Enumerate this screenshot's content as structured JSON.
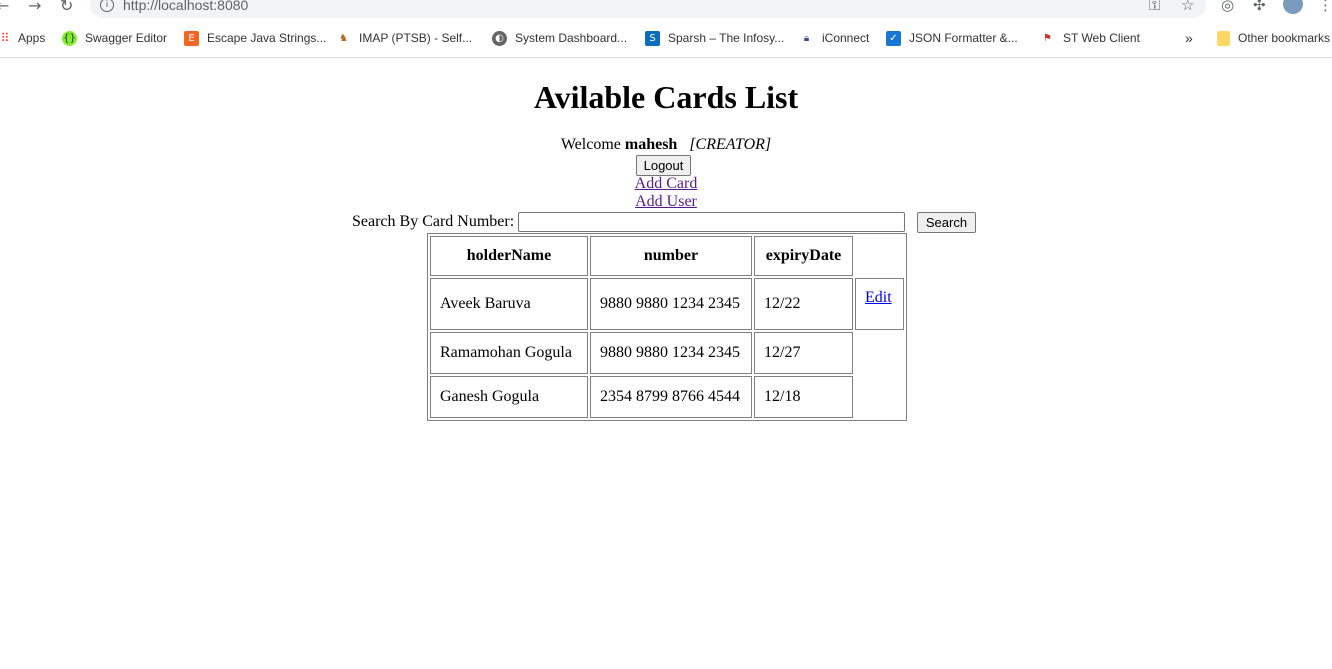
{
  "browser": {
    "url": "http://localhost:8080",
    "bookmarks": [
      {
        "label": "Apps",
        "icon": "apps-grid-icon"
      },
      {
        "label": "Swagger Editor",
        "icon": "swagger-icon"
      },
      {
        "label": "Escape Java Strings...",
        "icon": "e-logo-icon"
      },
      {
        "label": "IMAP (PTSB) - Self...",
        "icon": "camel-icon"
      },
      {
        "label": "System Dashboard...",
        "icon": "globe-icon"
      },
      {
        "label": "Sparsh – The Infosy...",
        "icon": "s-logo-icon"
      },
      {
        "label": "iConnect",
        "icon": "lock-icon"
      },
      {
        "label": "JSON Formatter &...",
        "icon": "check-icon"
      },
      {
        "label": "ST Web Client",
        "icon": "st-logo-icon"
      },
      {
        "label": "Other bookmarks",
        "icon": "folder-icon"
      }
    ],
    "overflow_label": "»"
  },
  "page": {
    "title": "Avilable Cards List",
    "welcome_prefix": "Welcome",
    "username": "mahesh",
    "role": "[CREATOR]",
    "logout_label": "Logout",
    "add_card_label": "Add Card",
    "add_user_label": "Add User",
    "search_label": "Search By Card Number:",
    "search_value": "",
    "search_button": "Search"
  },
  "table": {
    "headers": [
      "holderName",
      "number",
      "expiryDate"
    ],
    "rows": [
      {
        "holderName": "Aveek Baruva",
        "number": "9880 9880 1234 2345",
        "expiryDate": "12/22",
        "action": "Edit"
      },
      {
        "holderName": "Ramamohan Gogula",
        "number": "9880 9880 1234 2345",
        "expiryDate": "12/27"
      },
      {
        "holderName": "Ganesh Gogula",
        "number": "2354 8799 8766 4544",
        "expiryDate": "12/18"
      }
    ]
  }
}
